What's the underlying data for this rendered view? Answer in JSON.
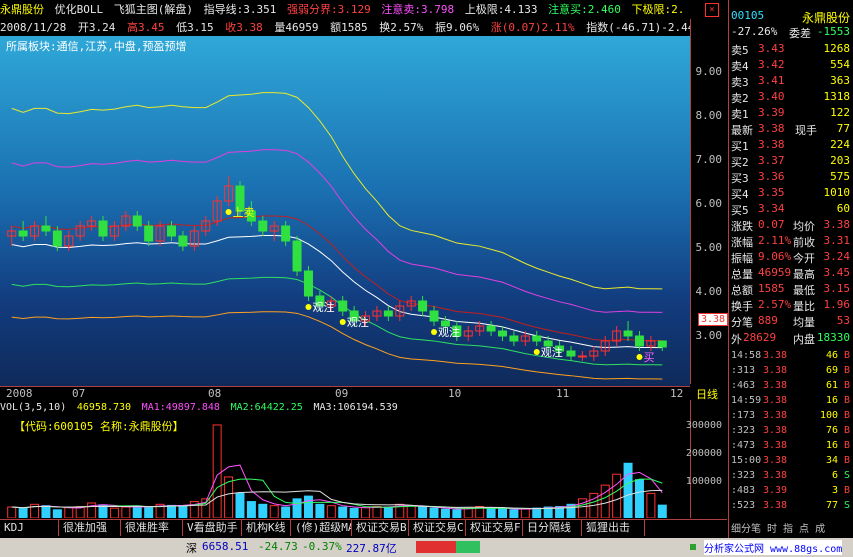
{
  "header": {
    "stock_name": "永鼎股份",
    "indicator_set": "优化BOLL",
    "window_title": "飞狐主图(解盘)",
    "guide_label": "指导线:3.351",
    "strong_weak": "强弱分界:3.129",
    "watch_sell": "注意卖:3.798",
    "upper_limit": "上极限:4.133",
    "watch_buy": "注意买:2.460",
    "lower_limit": "下极限:2.",
    "close_label": "×"
  },
  "infobar": {
    "date": "2008/11/28",
    "open": "开3.24",
    "high": "高3.45",
    "low": "低3.15",
    "close": "收3.38",
    "volume": "量46959",
    "amount": "额1585",
    "turnover": "换2.57%",
    "amplitude": "振9.06%",
    "change": "涨(0.07)2.11%",
    "index": "指数(-46.71)-2.44%"
  },
  "chart_note": "所属板块:通信,江苏,中盘,预盈预增",
  "annotations": [
    "上卖",
    "观注",
    "观注",
    "观注",
    "观注",
    "买"
  ],
  "yaxis_ticks": [
    "9.00",
    "8.00",
    "7.00",
    "6.00",
    "5.00",
    "4.00",
    "3.00"
  ],
  "price_tag": "3.38",
  "xaxis": {
    "labels": [
      "2008",
      "07",
      "08",
      "09",
      "10",
      "11",
      "12"
    ],
    "right_label": "日线"
  },
  "volume_header": {
    "vol": "VOL(3,5,10)",
    "vol_value": "46958.730",
    "ma1": "MA1:49897.848",
    "ma2": "MA2:64422.25",
    "ma3": "MA3:106194.539",
    "code_line": "【代码:600105 名称:永鼎股份】"
  },
  "vol_yaxis": [
    "300000",
    "200000",
    "100000"
  ],
  "chart_data": [
    {
      "type": "candlestick",
      "x": [
        "2008",
        "07",
        "08",
        "09",
        "10",
        "11",
        "12"
      ],
      "ylim": [
        2.6,
        9.6
      ],
      "values": [
        [
          5.6,
          5.8,
          5.4,
          5.7
        ],
        [
          5.7,
          5.9,
          5.5,
          5.6
        ],
        [
          5.6,
          5.9,
          5.5,
          5.8
        ],
        [
          5.8,
          6.0,
          5.6,
          5.7
        ],
        [
          5.7,
          5.8,
          5.3,
          5.4
        ],
        [
          5.4,
          5.7,
          5.3,
          5.6
        ],
        [
          5.6,
          5.9,
          5.5,
          5.8
        ],
        [
          5.8,
          6.0,
          5.7,
          5.9
        ],
        [
          5.9,
          6.0,
          5.5,
          5.6
        ],
        [
          5.6,
          5.9,
          5.5,
          5.8
        ],
        [
          5.8,
          6.1,
          5.7,
          6.0
        ],
        [
          6.0,
          6.1,
          5.7,
          5.8
        ],
        [
          5.8,
          5.9,
          5.4,
          5.5
        ],
        [
          5.5,
          5.9,
          5.4,
          5.8
        ],
        [
          5.8,
          5.9,
          5.5,
          5.6
        ],
        [
          5.6,
          5.7,
          5.3,
          5.4
        ],
        [
          5.4,
          5.8,
          5.3,
          5.7
        ],
        [
          5.7,
          6.0,
          5.6,
          5.9
        ],
        [
          5.9,
          6.4,
          5.8,
          6.3
        ],
        [
          6.3,
          6.8,
          6.2,
          6.6
        ],
        [
          6.6,
          6.7,
          6.0,
          6.1
        ],
        [
          6.1,
          6.3,
          5.8,
          5.9
        ],
        [
          5.9,
          6.0,
          5.6,
          5.7
        ],
        [
          5.7,
          5.9,
          5.5,
          5.8
        ],
        [
          5.8,
          5.9,
          5.4,
          5.5
        ],
        [
          5.5,
          5.6,
          4.8,
          4.9
        ],
        [
          4.9,
          5.0,
          4.3,
          4.4
        ],
        [
          4.4,
          4.5,
          4.1,
          4.2
        ],
        [
          4.2,
          4.4,
          4.1,
          4.3
        ],
        [
          4.3,
          4.4,
          4.0,
          4.1
        ],
        [
          4.1,
          4.2,
          3.8,
          3.9
        ],
        [
          3.9,
          4.1,
          3.8,
          4.0
        ],
        [
          4.0,
          4.2,
          3.9,
          4.1
        ],
        [
          4.1,
          4.2,
          3.9,
          4.0
        ],
        [
          4.0,
          4.3,
          3.9,
          4.2
        ],
        [
          4.2,
          4.4,
          4.1,
          4.3
        ],
        [
          4.3,
          4.4,
          4.0,
          4.1
        ],
        [
          4.1,
          4.2,
          3.8,
          3.9
        ],
        [
          3.9,
          4.0,
          3.7,
          3.8
        ],
        [
          3.8,
          3.9,
          3.5,
          3.6
        ],
        [
          3.6,
          3.8,
          3.5,
          3.7
        ],
        [
          3.7,
          3.9,
          3.6,
          3.8
        ],
        [
          3.8,
          3.9,
          3.6,
          3.7
        ],
        [
          3.7,
          3.8,
          3.5,
          3.6
        ],
        [
          3.6,
          3.7,
          3.4,
          3.5
        ],
        [
          3.5,
          3.7,
          3.4,
          3.6
        ],
        [
          3.6,
          3.7,
          3.4,
          3.5
        ],
        [
          3.5,
          3.6,
          3.3,
          3.4
        ],
        [
          3.4,
          3.5,
          3.2,
          3.3
        ],
        [
          3.3,
          3.4,
          3.1,
          3.2
        ],
        [
          3.2,
          3.3,
          3.1,
          3.2
        ],
        [
          3.2,
          3.4,
          3.1,
          3.3
        ],
        [
          3.3,
          3.6,
          3.2,
          3.5
        ],
        [
          3.5,
          3.8,
          3.4,
          3.7
        ],
        [
          3.7,
          3.9,
          3.5,
          3.6
        ],
        [
          3.6,
          3.7,
          3.3,
          3.4
        ],
        [
          3.4,
          3.6,
          3.3,
          3.5
        ],
        [
          3.5,
          3.5,
          3.3,
          3.38
        ]
      ]
    },
    {
      "type": "bar",
      "title": "VOL(3,5,10)",
      "ylim": [
        0,
        380000
      ],
      "values": [
        40000,
        35000,
        50000,
        45000,
        30000,
        38000,
        42000,
        55000,
        48000,
        36000,
        40000,
        44000,
        38000,
        50000,
        46000,
        42000,
        60000,
        70000,
        340000,
        150000,
        90000,
        60000,
        50000,
        45000,
        40000,
        70000,
        80000,
        50000,
        45000,
        40000,
        35000,
        38000,
        42000,
        40000,
        50000,
        45000,
        40000,
        36000,
        32000,
        30000,
        38000,
        42000,
        36000,
        33000,
        30000,
        34000,
        36000,
        40000,
        42000,
        50000,
        70000,
        90000,
        120000,
        160000,
        200000,
        140000,
        90000,
        46958
      ]
    }
  ],
  "tabs": [
    "KDJ",
    "很准加强",
    "很准胜率",
    "V看盘助手",
    "机构K线",
    "(修)超级MACD",
    "权证交易B",
    "权证交易C",
    "权证交易F",
    "日分隔线",
    "狐狸出击"
  ],
  "status": {
    "index_name": "深",
    "index_value": "6658.51",
    "change": "-24.73",
    "pct": "-0.37%",
    "amount": "227.87亿",
    "site": "分析家公式网 www.88gs.com"
  },
  "panel": {
    "code": "00105",
    "name": "永鼎股份",
    "ratio": "-27.26%",
    "ratio_label": "委差",
    "ratio_value": "-1553",
    "asks": [
      {
        "label": "卖5",
        "price": "3.43",
        "vol": "1268"
      },
      {
        "label": "卖4",
        "price": "3.42",
        "vol": "554"
      },
      {
        "label": "卖3",
        "price": "3.41",
        "vol": "363"
      },
      {
        "label": "卖2",
        "price": "3.40",
        "vol": "1318"
      },
      {
        "label": "卖1",
        "price": "3.39",
        "vol": "122"
      }
    ],
    "last": {
      "label": "最新",
      "price": "3.38",
      "k2": "现手",
      "v2": "77"
    },
    "bids": [
      {
        "label": "买1",
        "price": "3.38",
        "vol": "224"
      },
      {
        "label": "买2",
        "price": "3.37",
        "vol": "203"
      },
      {
        "label": "买3",
        "price": "3.36",
        "vol": "575"
      },
      {
        "label": "买4",
        "price": "3.35",
        "vol": "1010"
      },
      {
        "label": "买5",
        "price": "3.34",
        "vol": "60"
      }
    ],
    "stats": [
      {
        "k1": "涨跌",
        "v1": "0.07",
        "k2": "均价",
        "v2": "3.38"
      },
      {
        "k1": "涨幅",
        "v1": "2.11%",
        "k2": "前收",
        "v2": "3.31"
      },
      {
        "k1": "振幅",
        "v1": "9.06%",
        "k2": "今开",
        "v2": "3.24"
      },
      {
        "k1": "总量",
        "v1": "46959",
        "k2": "最高",
        "v2": "3.45"
      },
      {
        "k1": "总额",
        "v1": "1585",
        "k2": "最低",
        "v2": "3.15"
      },
      {
        "k1": "换手",
        "v1": "2.57%",
        "k2": "量比",
        "v2": "1.96"
      },
      {
        "k1": "分笔",
        "v1": "889",
        "k2": "均量",
        "v2": "53"
      }
    ],
    "outer": "外",
    "outer_value": "28629",
    "inner": "内盘",
    "inner_value": "18330",
    "ticks": [
      {
        "t": "14:58",
        "p": "3.38",
        "v": "46",
        "bs": "B"
      },
      {
        "t": ":313",
        "p": "3.38",
        "v": "69",
        "bs": "B"
      },
      {
        "t": ":463",
        "p": "3.38",
        "v": "61",
        "bs": "B"
      },
      {
        "t": "14:59",
        "p": "3.38",
        "v": "16",
        "bs": "B"
      },
      {
        "t": ":173",
        "p": "3.38",
        "v": "100",
        "bs": "B"
      },
      {
        "t": ":323",
        "p": "3.38",
        "v": "76",
        "bs": "B"
      },
      {
        "t": ":473",
        "p": "3.38",
        "v": "16",
        "bs": "B"
      },
      {
        "t": "15:00",
        "p": "3.38",
        "v": "34",
        "bs": "B"
      },
      {
        "t": ":323",
        "p": "3.38",
        "v": "6",
        "bs": "S"
      },
      {
        "t": ":483",
        "p": "3.39",
        "v": "3",
        "bs": "B"
      },
      {
        "t": ":523",
        "p": "3.38",
        "v": "77",
        "bs": "S"
      }
    ],
    "footer": "细分笔 时 指 点 成"
  }
}
